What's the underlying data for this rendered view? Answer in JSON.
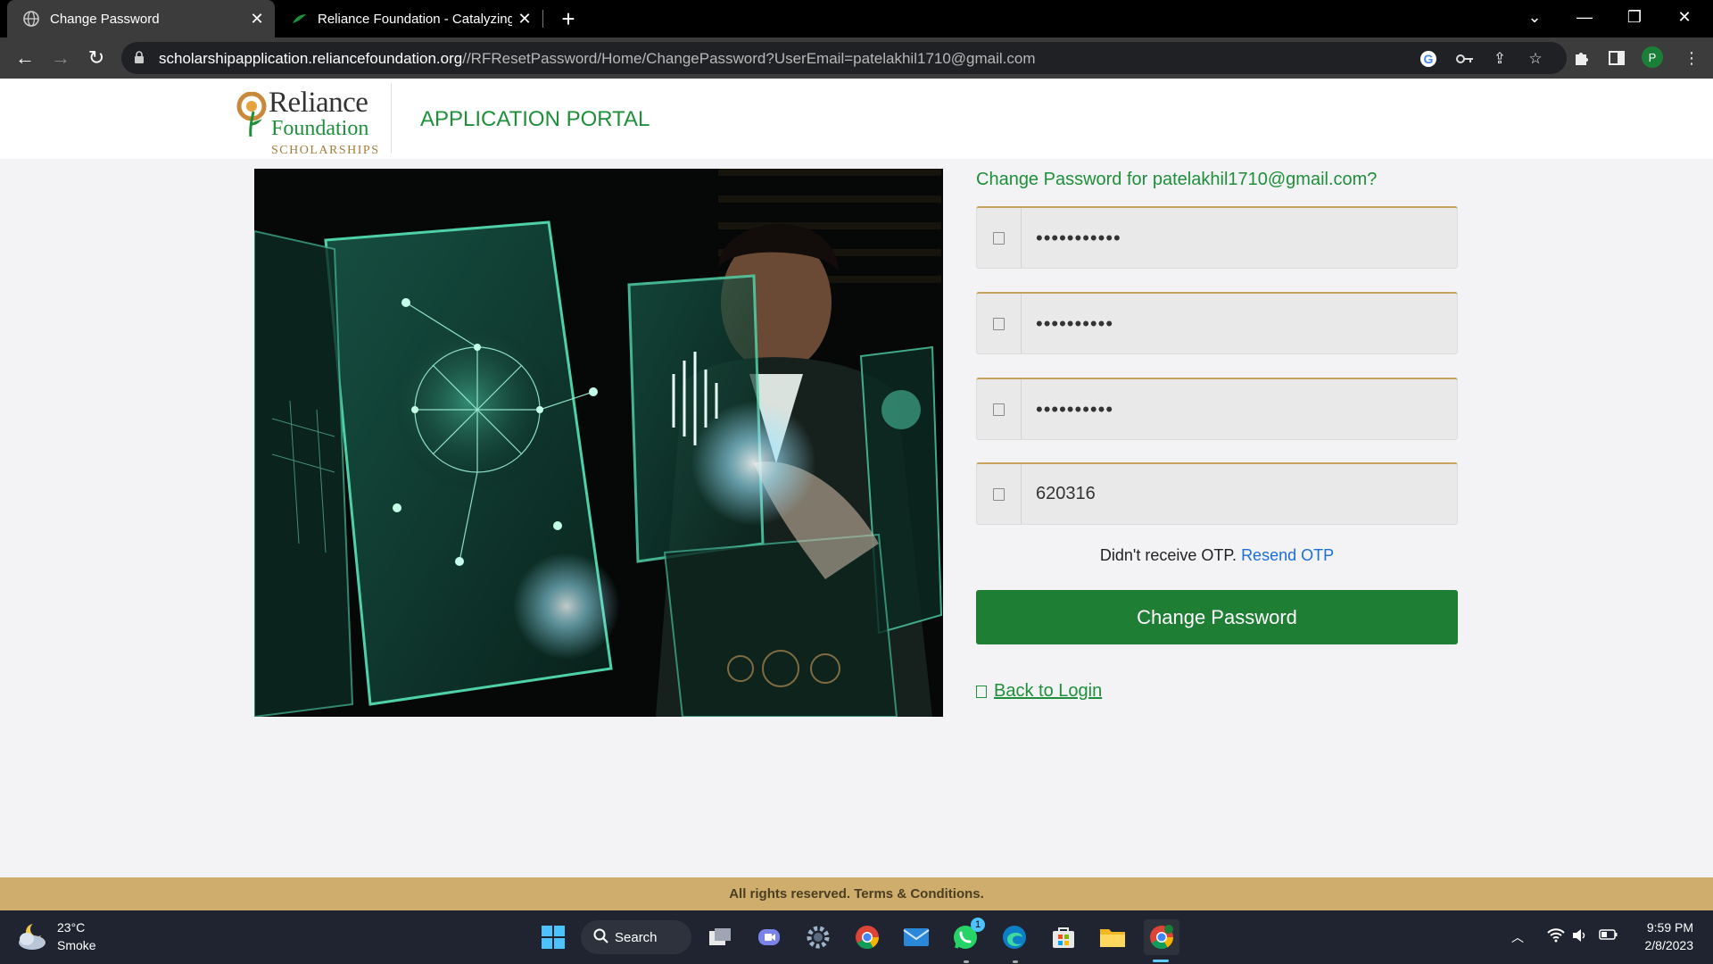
{
  "browser": {
    "tabs": [
      {
        "title": "Change Password",
        "active": true
      },
      {
        "title": "Reliance Foundation - Catalyzing",
        "active": false
      }
    ],
    "url_host": "scholarshipapplication.reliancefoundation.org",
    "url_path": "//RFResetPassword/Home/ChangePassword?UserEmail=patelakhil1710@gmail.com",
    "profile_initial": "P"
  },
  "header": {
    "logo_line1": "Reliance",
    "logo_line2": "Foundation",
    "logo_line3": "SCHOLARSHIPS",
    "portal_title": "APPLICATION PORTAL"
  },
  "form": {
    "title": "Change Password for patelakhil1710@gmail.com?",
    "fields": [
      {
        "value": "•••••••••••",
        "type": "password"
      },
      {
        "value": "••••••••••",
        "type": "password"
      },
      {
        "value": "••••••••••",
        "type": "password"
      },
      {
        "value": "620316",
        "type": "text"
      }
    ],
    "otp_prompt": "Didn't receive OTP.",
    "resend_label": "Resend OTP",
    "submit_label": "Change Password",
    "back_label": "Back to Login"
  },
  "footer": {
    "text": "All rights reserved. Terms & Conditions."
  },
  "taskbar": {
    "weather_temp": "23°C",
    "weather_condition": "Smoke",
    "search_label": "Search",
    "whatsapp_badge": "1",
    "time": "9:59 PM",
    "date": "2/8/2023"
  },
  "colors": {
    "brand_green": "#1e8f3a",
    "button_green": "#1e7e34",
    "footer_gold": "#cfae6d",
    "link_blue": "#1a6fd6"
  }
}
